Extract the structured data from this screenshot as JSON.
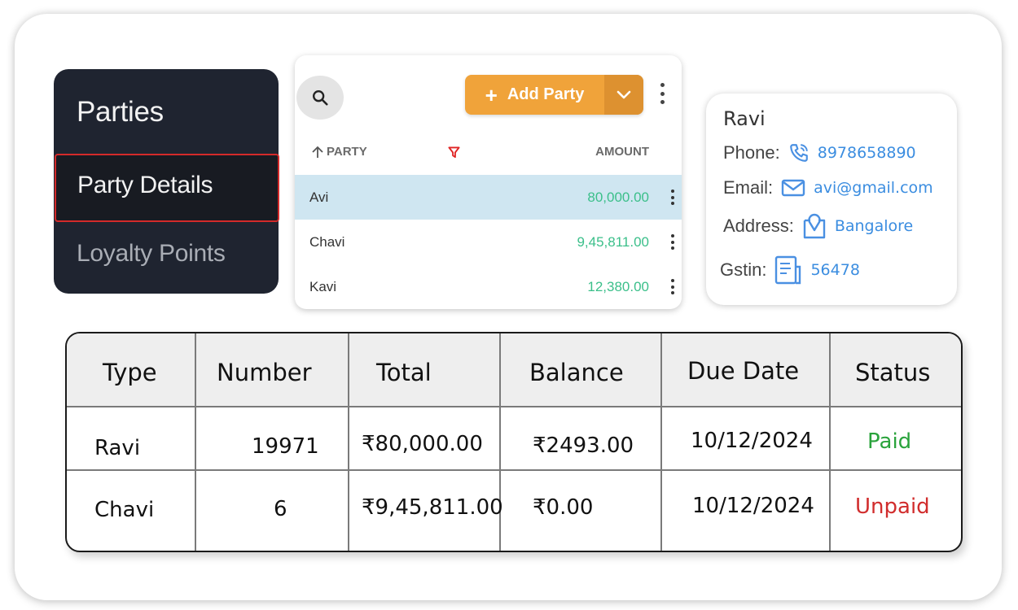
{
  "sidebar": {
    "title": "Parties",
    "items": [
      {
        "label": "Party Details",
        "active": true
      },
      {
        "label": "Loyalty Points",
        "active": false
      }
    ]
  },
  "party_list": {
    "search_icon": "search-icon",
    "add_button_label": "Add Party",
    "add_button_icon": "+",
    "colors": {
      "accent": "#f0a33a",
      "amount": "#3bbf8a",
      "selected_row": "#cfe6f1"
    },
    "columns": {
      "party": "PARTY",
      "amount": "AMOUNT"
    },
    "rows": [
      {
        "name": "Avi",
        "amount": "80,000.00",
        "selected": true
      },
      {
        "name": "Chavi",
        "amount": "9,45,811.00",
        "selected": false
      },
      {
        "name": "Kavi",
        "amount": "12,380.00",
        "selected": false
      }
    ]
  },
  "contact": {
    "name": "Ravi",
    "phone_label": "Phone:",
    "phone": "8978658890",
    "email_label": "Email:",
    "email": "avi@gmail.com",
    "address_label": "Address:",
    "address": "Bangalore",
    "gstin_label": "Gstin:",
    "gstin": "56478"
  },
  "invoices": {
    "headers": [
      "Type",
      "Number",
      "Total",
      "Balance",
      "Due Date",
      "Status"
    ],
    "rows": [
      {
        "type": "Ravi",
        "number": "19971",
        "total": "₹80,000.00",
        "balance": "₹2493.00",
        "due_date": "10/12/2024",
        "status": "Paid"
      },
      {
        "type": "Chavi",
        "number": "6",
        "total": "₹9,45,811.00",
        "balance": "₹0.00",
        "due_date": "10/12/2024",
        "status": "Unpaid"
      }
    ],
    "status_colors": {
      "Paid": "#2aa33c",
      "Unpaid": "#d12d2d"
    }
  }
}
